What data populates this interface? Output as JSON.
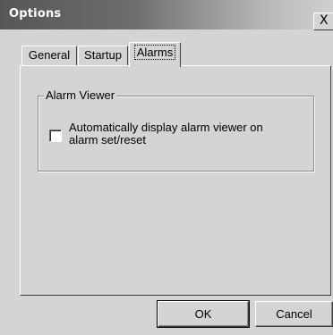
{
  "window": {
    "title": "Options",
    "close_label": "X"
  },
  "tabs": [
    {
      "label": "General",
      "selected": false
    },
    {
      "label": "Startup",
      "selected": false
    },
    {
      "label": "Alarms",
      "selected": true
    }
  ],
  "alarms_page": {
    "group_title": "Alarm Viewer",
    "checkbox": {
      "label_line1": "Automatically display alarm viewer on",
      "label_line2": "alarm set/reset",
      "checked": false
    }
  },
  "buttons": {
    "ok_label": "OK",
    "cancel_label": "Cancel"
  }
}
